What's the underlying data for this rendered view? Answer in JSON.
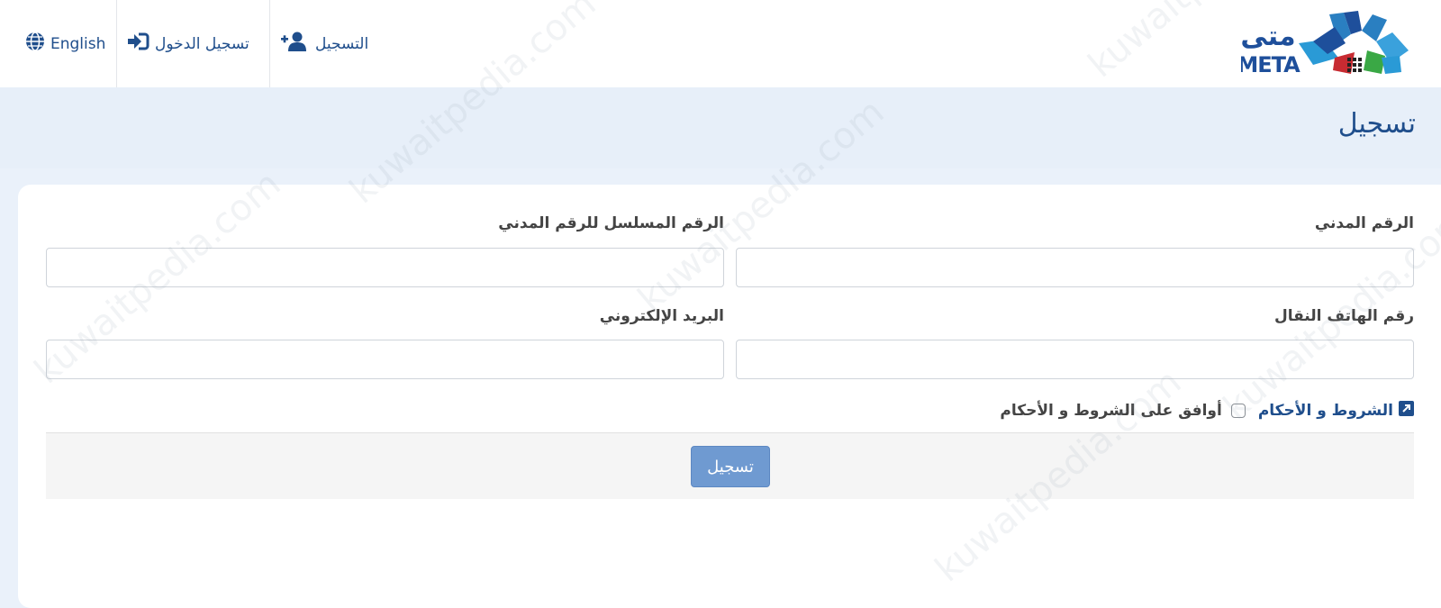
{
  "header": {
    "logo": {
      "arabic_text": "متى",
      "latin_text": "META"
    },
    "nav": [
      {
        "label": "التسجيل",
        "icon": "user-plus-icon"
      },
      {
        "label": "تسجيل الدخول",
        "icon": "sign-in-icon"
      },
      {
        "label": "English",
        "icon": "globe-icon"
      }
    ]
  },
  "page": {
    "title": "تسجيل"
  },
  "form": {
    "civil_id": {
      "label": "الرقم المدني",
      "value": ""
    },
    "civil_id_serial": {
      "label": "الرقم المسلسل للرقم المدني",
      "value": ""
    },
    "mobile": {
      "label": "رقم الهاتف النقال",
      "value": ""
    },
    "email": {
      "label": "البريد الإلكتروني",
      "value": ""
    },
    "terms": {
      "link_label": "الشروط و الأحكام",
      "link_icon": "external-link-icon",
      "agree_label": "أوافق على الشروط و الأحكام",
      "checked": false
    },
    "submit_label": "تسجيل"
  },
  "watermark": "kuwaitpedia.com",
  "colors": {
    "primary": "#1f4e8c",
    "button": "#6f9ad1",
    "background": "#eaf1fa"
  }
}
